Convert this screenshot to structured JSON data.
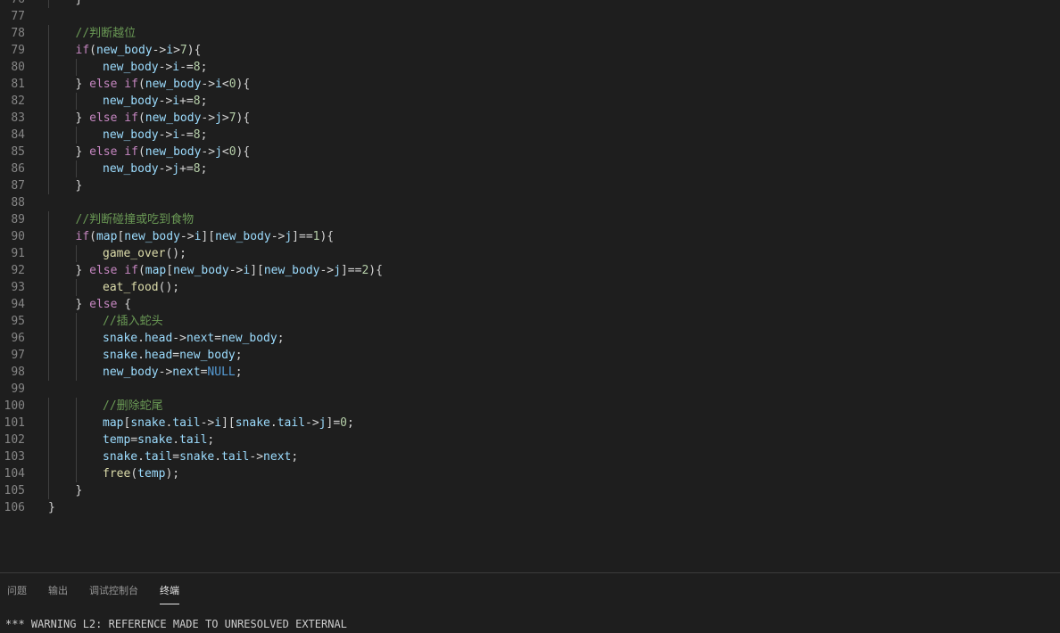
{
  "editor": {
    "lines": [
      {
        "n": "76",
        "indent": 1,
        "tokens": [
          {
            "t": "}",
            "c": "op"
          }
        ]
      },
      {
        "n": "77",
        "indent": 0,
        "tokens": []
      },
      {
        "n": "78",
        "indent": 1,
        "tokens": [
          {
            "t": "//判断越位",
            "c": "cmt"
          }
        ]
      },
      {
        "n": "79",
        "indent": 1,
        "tokens": [
          {
            "t": "if",
            "c": "kw"
          },
          {
            "t": "(",
            "c": "op"
          },
          {
            "t": "new_body",
            "c": "var"
          },
          {
            "t": "->",
            "c": "op"
          },
          {
            "t": "i",
            "c": "var"
          },
          {
            "t": ">",
            "c": "op"
          },
          {
            "t": "7",
            "c": "num"
          },
          {
            "t": "){",
            "c": "op"
          }
        ]
      },
      {
        "n": "80",
        "indent": 2,
        "tokens": [
          {
            "t": "new_body",
            "c": "var"
          },
          {
            "t": "->",
            "c": "op"
          },
          {
            "t": "i",
            "c": "var"
          },
          {
            "t": "-=",
            "c": "op"
          },
          {
            "t": "8",
            "c": "num"
          },
          {
            "t": ";",
            "c": "op"
          }
        ]
      },
      {
        "n": "81",
        "indent": 1,
        "tokens": [
          {
            "t": "} ",
            "c": "op"
          },
          {
            "t": "else",
            "c": "kw"
          },
          {
            "t": " ",
            "c": "op"
          },
          {
            "t": "if",
            "c": "kw"
          },
          {
            "t": "(",
            "c": "op"
          },
          {
            "t": "new_body",
            "c": "var"
          },
          {
            "t": "->",
            "c": "op"
          },
          {
            "t": "i",
            "c": "var"
          },
          {
            "t": "<",
            "c": "op"
          },
          {
            "t": "0",
            "c": "num"
          },
          {
            "t": "){",
            "c": "op"
          }
        ]
      },
      {
        "n": "82",
        "indent": 2,
        "tokens": [
          {
            "t": "new_body",
            "c": "var"
          },
          {
            "t": "->",
            "c": "op"
          },
          {
            "t": "i",
            "c": "var"
          },
          {
            "t": "+=",
            "c": "op"
          },
          {
            "t": "8",
            "c": "num"
          },
          {
            "t": ";",
            "c": "op"
          }
        ]
      },
      {
        "n": "83",
        "indent": 1,
        "tokens": [
          {
            "t": "} ",
            "c": "op"
          },
          {
            "t": "else",
            "c": "kw"
          },
          {
            "t": " ",
            "c": "op"
          },
          {
            "t": "if",
            "c": "kw"
          },
          {
            "t": "(",
            "c": "op"
          },
          {
            "t": "new_body",
            "c": "var"
          },
          {
            "t": "->",
            "c": "op"
          },
          {
            "t": "j",
            "c": "var"
          },
          {
            "t": ">",
            "c": "op"
          },
          {
            "t": "7",
            "c": "num"
          },
          {
            "t": "){",
            "c": "op"
          }
        ]
      },
      {
        "n": "84",
        "indent": 2,
        "tokens": [
          {
            "t": "new_body",
            "c": "var"
          },
          {
            "t": "->",
            "c": "op"
          },
          {
            "t": "i",
            "c": "var"
          },
          {
            "t": "-=",
            "c": "op"
          },
          {
            "t": "8",
            "c": "num"
          },
          {
            "t": ";",
            "c": "op"
          }
        ]
      },
      {
        "n": "85",
        "indent": 1,
        "tokens": [
          {
            "t": "} ",
            "c": "op"
          },
          {
            "t": "else",
            "c": "kw"
          },
          {
            "t": " ",
            "c": "op"
          },
          {
            "t": "if",
            "c": "kw"
          },
          {
            "t": "(",
            "c": "op"
          },
          {
            "t": "new_body",
            "c": "var"
          },
          {
            "t": "->",
            "c": "op"
          },
          {
            "t": "j",
            "c": "var"
          },
          {
            "t": "<",
            "c": "op"
          },
          {
            "t": "0",
            "c": "num"
          },
          {
            "t": "){",
            "c": "op"
          }
        ]
      },
      {
        "n": "86",
        "indent": 2,
        "tokens": [
          {
            "t": "new_body",
            "c": "var"
          },
          {
            "t": "->",
            "c": "op"
          },
          {
            "t": "j",
            "c": "var"
          },
          {
            "t": "+=",
            "c": "op"
          },
          {
            "t": "8",
            "c": "num"
          },
          {
            "t": ";",
            "c": "op"
          }
        ]
      },
      {
        "n": "87",
        "indent": 1,
        "tokens": [
          {
            "t": "}",
            "c": "op"
          }
        ]
      },
      {
        "n": "88",
        "indent": 0,
        "tokens": []
      },
      {
        "n": "89",
        "indent": 1,
        "tokens": [
          {
            "t": "//判断碰撞或吃到食物",
            "c": "cmt"
          }
        ]
      },
      {
        "n": "90",
        "indent": 1,
        "tokens": [
          {
            "t": "if",
            "c": "kw"
          },
          {
            "t": "(",
            "c": "op"
          },
          {
            "t": "map",
            "c": "var"
          },
          {
            "t": "[",
            "c": "op"
          },
          {
            "t": "new_body",
            "c": "var"
          },
          {
            "t": "->",
            "c": "op"
          },
          {
            "t": "i",
            "c": "var"
          },
          {
            "t": "][",
            "c": "op"
          },
          {
            "t": "new_body",
            "c": "var"
          },
          {
            "t": "->",
            "c": "op"
          },
          {
            "t": "j",
            "c": "var"
          },
          {
            "t": "]==",
            "c": "op"
          },
          {
            "t": "1",
            "c": "num"
          },
          {
            "t": "){",
            "c": "op"
          }
        ]
      },
      {
        "n": "91",
        "indent": 2,
        "tokens": [
          {
            "t": "game_over",
            "c": "fn"
          },
          {
            "t": "();",
            "c": "op"
          }
        ]
      },
      {
        "n": "92",
        "indent": 1,
        "tokens": [
          {
            "t": "} ",
            "c": "op"
          },
          {
            "t": "else",
            "c": "kw"
          },
          {
            "t": " ",
            "c": "op"
          },
          {
            "t": "if",
            "c": "kw"
          },
          {
            "t": "(",
            "c": "op"
          },
          {
            "t": "map",
            "c": "var"
          },
          {
            "t": "[",
            "c": "op"
          },
          {
            "t": "new_body",
            "c": "var"
          },
          {
            "t": "->",
            "c": "op"
          },
          {
            "t": "i",
            "c": "var"
          },
          {
            "t": "][",
            "c": "op"
          },
          {
            "t": "new_body",
            "c": "var"
          },
          {
            "t": "->",
            "c": "op"
          },
          {
            "t": "j",
            "c": "var"
          },
          {
            "t": "]==",
            "c": "op"
          },
          {
            "t": "2",
            "c": "num"
          },
          {
            "t": "){",
            "c": "op"
          }
        ]
      },
      {
        "n": "93",
        "indent": 2,
        "tokens": [
          {
            "t": "eat_food",
            "c": "fn"
          },
          {
            "t": "();",
            "c": "op"
          }
        ]
      },
      {
        "n": "94",
        "indent": 1,
        "tokens": [
          {
            "t": "} ",
            "c": "op"
          },
          {
            "t": "else",
            "c": "kw"
          },
          {
            "t": " {",
            "c": "op"
          }
        ]
      },
      {
        "n": "95",
        "indent": 2,
        "tokens": [
          {
            "t": "//插入蛇头",
            "c": "cmt"
          }
        ]
      },
      {
        "n": "96",
        "indent": 2,
        "tokens": [
          {
            "t": "snake",
            "c": "var"
          },
          {
            "t": ".",
            "c": "op"
          },
          {
            "t": "head",
            "c": "var"
          },
          {
            "t": "->",
            "c": "op"
          },
          {
            "t": "next",
            "c": "var"
          },
          {
            "t": "=",
            "c": "op"
          },
          {
            "t": "new_body",
            "c": "var"
          },
          {
            "t": ";",
            "c": "op"
          }
        ]
      },
      {
        "n": "97",
        "indent": 2,
        "tokens": [
          {
            "t": "snake",
            "c": "var"
          },
          {
            "t": ".",
            "c": "op"
          },
          {
            "t": "head",
            "c": "var"
          },
          {
            "t": "=",
            "c": "op"
          },
          {
            "t": "new_body",
            "c": "var"
          },
          {
            "t": ";",
            "c": "op"
          }
        ]
      },
      {
        "n": "98",
        "indent": 2,
        "tokens": [
          {
            "t": "new_body",
            "c": "var"
          },
          {
            "t": "->",
            "c": "op"
          },
          {
            "t": "next",
            "c": "var"
          },
          {
            "t": "=",
            "c": "op"
          },
          {
            "t": "NULL",
            "c": "const"
          },
          {
            "t": ";",
            "c": "op"
          }
        ]
      },
      {
        "n": "99",
        "indent": 0,
        "tokens": []
      },
      {
        "n": "100",
        "indent": 2,
        "tokens": [
          {
            "t": "//删除蛇尾",
            "c": "cmt"
          }
        ]
      },
      {
        "n": "101",
        "indent": 2,
        "tokens": [
          {
            "t": "map",
            "c": "var"
          },
          {
            "t": "[",
            "c": "op"
          },
          {
            "t": "snake",
            "c": "var"
          },
          {
            "t": ".",
            "c": "op"
          },
          {
            "t": "tail",
            "c": "var"
          },
          {
            "t": "->",
            "c": "op"
          },
          {
            "t": "i",
            "c": "var"
          },
          {
            "t": "][",
            "c": "op"
          },
          {
            "t": "snake",
            "c": "var"
          },
          {
            "t": ".",
            "c": "op"
          },
          {
            "t": "tail",
            "c": "var"
          },
          {
            "t": "->",
            "c": "op"
          },
          {
            "t": "j",
            "c": "var"
          },
          {
            "t": "]=",
            "c": "op"
          },
          {
            "t": "0",
            "c": "num"
          },
          {
            "t": ";",
            "c": "op"
          }
        ]
      },
      {
        "n": "102",
        "indent": 2,
        "tokens": [
          {
            "t": "temp",
            "c": "var"
          },
          {
            "t": "=",
            "c": "op"
          },
          {
            "t": "snake",
            "c": "var"
          },
          {
            "t": ".",
            "c": "op"
          },
          {
            "t": "tail",
            "c": "var"
          },
          {
            "t": ";",
            "c": "op"
          }
        ]
      },
      {
        "n": "103",
        "indent": 2,
        "tokens": [
          {
            "t": "snake",
            "c": "var"
          },
          {
            "t": ".",
            "c": "op"
          },
          {
            "t": "tail",
            "c": "var"
          },
          {
            "t": "=",
            "c": "op"
          },
          {
            "t": "snake",
            "c": "var"
          },
          {
            "t": ".",
            "c": "op"
          },
          {
            "t": "tail",
            "c": "var"
          },
          {
            "t": "->",
            "c": "op"
          },
          {
            "t": "next",
            "c": "var"
          },
          {
            "t": ";",
            "c": "op"
          }
        ]
      },
      {
        "n": "104",
        "indent": 2,
        "tokens": [
          {
            "t": "free",
            "c": "fn"
          },
          {
            "t": "(",
            "c": "op"
          },
          {
            "t": "temp",
            "c": "var"
          },
          {
            "t": ");",
            "c": "op"
          }
        ]
      },
      {
        "n": "105",
        "indent": 1,
        "tokens": [
          {
            "t": "}",
            "c": "op"
          }
        ]
      },
      {
        "n": "106",
        "indent": 0,
        "tokens": [
          {
            "t": "}",
            "c": "op"
          }
        ]
      }
    ]
  },
  "panel": {
    "tabs": [
      {
        "label": "问题",
        "name": "tab-problems",
        "active": false
      },
      {
        "label": "输出",
        "name": "tab-output",
        "active": false
      },
      {
        "label": "调试控制台",
        "name": "tab-debug-console",
        "active": false
      },
      {
        "label": "终端",
        "name": "tab-terminal",
        "active": true
      }
    ],
    "terminal_output": "*** WARNING L2: REFERENCE MADE TO UNRESOLVED EXTERNAL"
  }
}
